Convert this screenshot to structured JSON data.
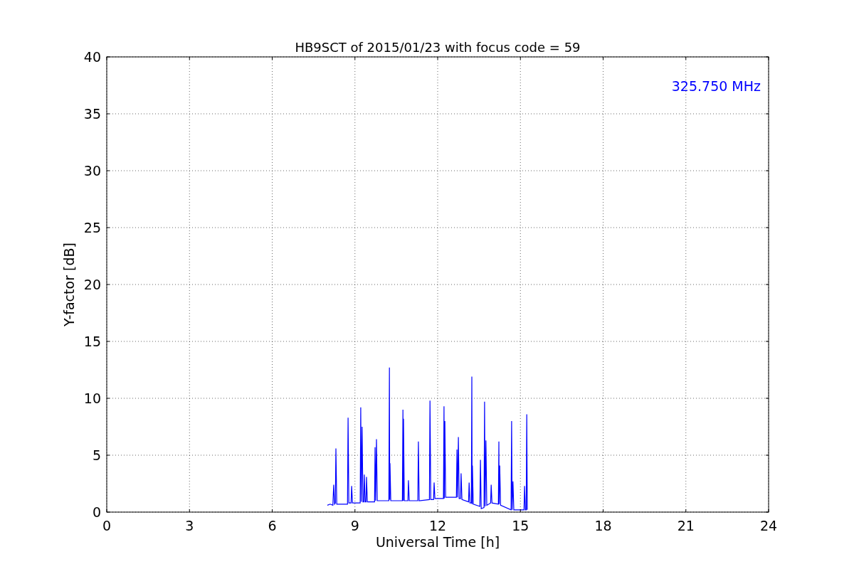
{
  "chart_data": {
    "type": "line",
    "title": "HB9SCT of 2015/01/23 with focus code = 59",
    "xlabel": "Universal Time [h]",
    "ylabel": "Y-factor [dB]",
    "x": [
      8.0,
      8.1,
      8.2,
      8.23,
      8.26,
      8.29,
      8.31,
      8.34,
      8.5,
      8.73,
      8.75,
      8.78,
      8.86,
      8.88,
      8.91,
      9.19,
      9.21,
      9.23,
      9.26,
      9.29,
      9.32,
      9.34,
      9.37,
      9.4,
      9.42,
      9.45,
      9.71,
      9.73,
      9.75,
      9.78,
      9.81,
      10.0,
      10.23,
      10.25,
      10.26,
      10.27,
      10.3,
      10.72,
      10.74,
      10.75,
      10.76,
      10.79,
      10.92,
      10.94,
      10.97,
      11.28,
      11.3,
      11.33,
      11.7,
      11.72,
      11.75,
      11.85,
      11.87,
      11.9,
      12.21,
      12.23,
      12.24,
      12.26,
      12.29,
      12.68,
      12.7,
      12.72,
      12.75,
      12.78,
      12.83,
      12.85,
      12.88,
      13.12,
      13.14,
      13.17,
      13.22,
      13.24,
      13.25,
      13.26,
      13.29,
      13.53,
      13.55,
      13.58,
      13.68,
      13.7,
      13.72,
      13.75,
      13.78,
      13.92,
      13.94,
      13.97,
      14.2,
      14.22,
      14.23,
      14.25,
      14.28,
      14.66,
      14.68,
      14.7,
      14.73,
      14.76,
      15.13,
      15.15,
      15.18,
      15.21,
      15.23,
      15.25
    ],
    "series": [
      {
        "name": "325.750 MHz",
        "color": "#0000ff",
        "values": [
          0.6,
          0.7,
          0.6,
          2.4,
          0.7,
          0.8,
          5.6,
          0.7,
          0.7,
          0.7,
          8.3,
          0.8,
          0.8,
          2.3,
          0.8,
          0.8,
          9.2,
          0.9,
          7.5,
          0.9,
          0.9,
          3.3,
          0.9,
          0.9,
          3.1,
          0.9,
          0.9,
          5.7,
          1.0,
          6.4,
          1.0,
          1.0,
          1.0,
          12.7,
          1.1,
          4.3,
          1.0,
          1.0,
          9.0,
          1.0,
          8.2,
          1.0,
          1.0,
          2.8,
          1.0,
          1.0,
          6.2,
          1.0,
          1.1,
          9.8,
          1.1,
          1.1,
          2.6,
          1.2,
          1.2,
          9.3,
          1.2,
          8.0,
          1.3,
          1.3,
          5.5,
          1.3,
          6.6,
          1.2,
          1.2,
          3.4,
          1.1,
          0.9,
          2.6,
          0.8,
          0.8,
          11.9,
          0.7,
          4.1,
          0.7,
          0.5,
          4.6,
          0.3,
          0.4,
          9.7,
          0.5,
          6.3,
          0.6,
          0.8,
          2.4,
          0.8,
          0.7,
          6.2,
          0.7,
          4.1,
          0.6,
          0.2,
          8.0,
          0.2,
          2.7,
          0.2,
          0.2,
          2.3,
          0.2,
          0.2,
          8.6,
          0.2
        ]
      }
    ],
    "xlim": [
      0,
      24
    ],
    "ylim": [
      0,
      40
    ],
    "xticks": [
      0,
      3,
      6,
      9,
      12,
      15,
      18,
      21,
      24
    ],
    "yticks": [
      0,
      5,
      10,
      15,
      20,
      25,
      30,
      35,
      40
    ],
    "grid": true
  }
}
